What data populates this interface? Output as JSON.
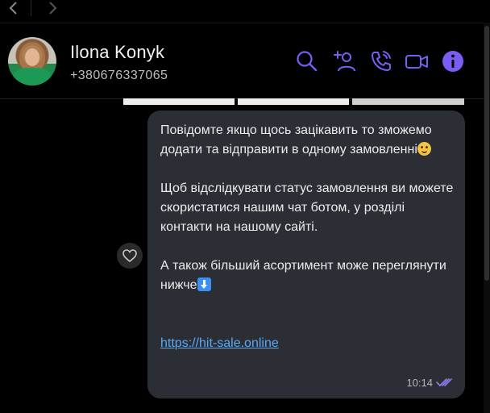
{
  "header": {
    "contact_name": "Ilona Konyk",
    "contact_phone": "+380676337065",
    "actions": [
      "search-icon",
      "add-participant-icon",
      "voice-call-icon",
      "video-call-icon",
      "info-icon"
    ]
  },
  "message": {
    "paragraph1": "Повідомте якщо щось зацікавить то зможемо додати та відправити в одному замовленні",
    "paragraph2": "Щоб відслідкувати статус замовлення ви можете скористатися нашим чат ботом, у розділі контакти на нашому сайті.",
    "paragraph3": "А також більший асортимент може переглянути  нижче",
    "link": "https://hit-sale.online",
    "time": "10:14"
  },
  "colors": {
    "accent": "#7b5cf5",
    "bubble": "#2b2e35",
    "link": "#5aa9f5"
  }
}
